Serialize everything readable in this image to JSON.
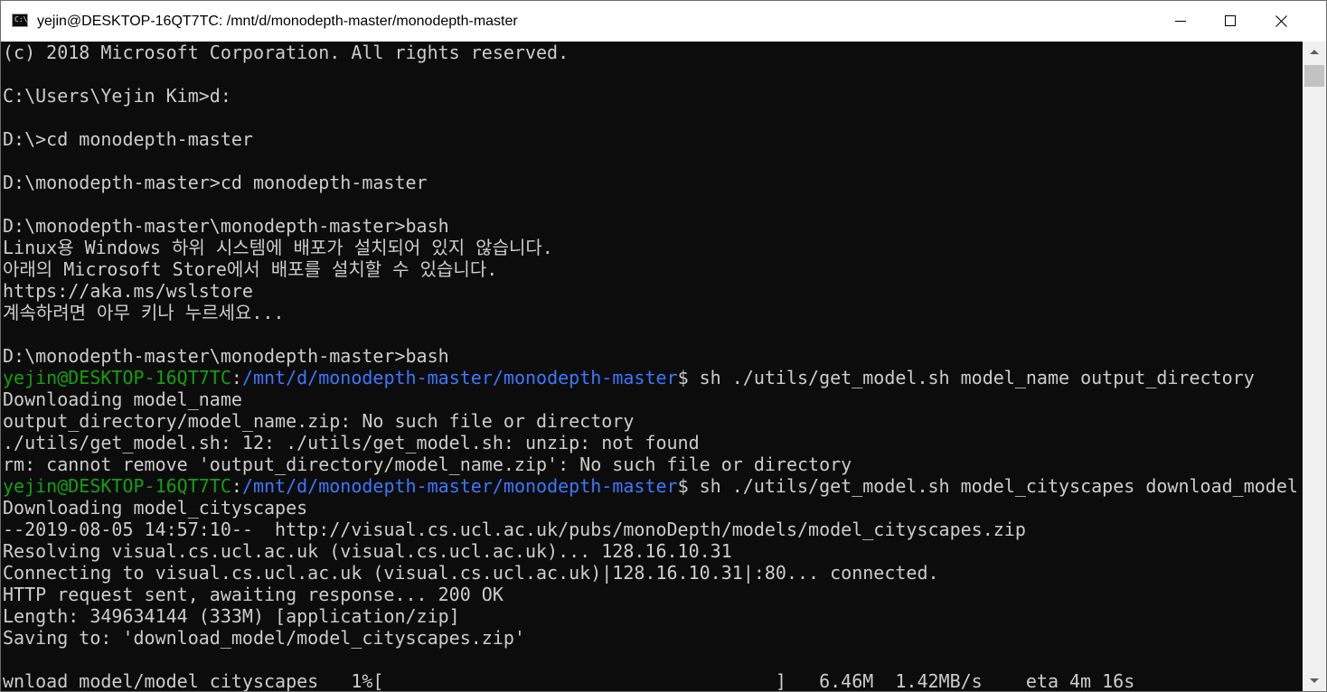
{
  "window": {
    "title": "yejin@DESKTOP-16QT7TC: /mnt/d/monodepth-master/monodepth-master",
    "icon_glyph": "C:\\",
    "colors": {
      "background": "#0c0c0c",
      "text": "#cccccc",
      "prompt_user": "#13a10e",
      "prompt_path": "#3b78ff"
    }
  },
  "console": {
    "lines": [
      {
        "text": "(c) 2018 Microsoft Corporation. All rights reserved."
      },
      {
        "text": ""
      },
      {
        "text": "C:\\Users\\Yejin Kim>d:"
      },
      {
        "text": ""
      },
      {
        "text": "D:\\>cd monodepth-master"
      },
      {
        "text": ""
      },
      {
        "text": "D:\\monodepth-master>cd monodepth-master"
      },
      {
        "text": ""
      },
      {
        "text": "D:\\monodepth-master\\monodepth-master>bash"
      },
      {
        "text": "Linux용 Windows 하위 시스템에 배포가 설치되어 있지 않습니다."
      },
      {
        "text": "아래의 Microsoft Store에서 배포를 설치할 수 있습니다."
      },
      {
        "text": "https://aka.ms/wslstore"
      },
      {
        "text": "계속하려면 아무 키나 누르세요..."
      },
      {
        "text": ""
      },
      {
        "text": "D:\\monodepth-master\\monodepth-master>bash"
      },
      {
        "user": "yejin@DESKTOP-16QT7TC",
        "sep": ":",
        "path": "/mnt/d/monodepth-master/monodepth-master",
        "cmd": "$ sh ./utils/get_model.sh model_name output_directory"
      },
      {
        "text": "Downloading model_name"
      },
      {
        "text": "output_directory/model_name.zip: No such file or directory"
      },
      {
        "text": "./utils/get_model.sh: 12: ./utils/get_model.sh: unzip: not found"
      },
      {
        "text": "rm: cannot remove 'output_directory/model_name.zip': No such file or directory"
      },
      {
        "user": "yejin@DESKTOP-16QT7TC",
        "sep": ":",
        "path": "/mnt/d/monodepth-master/monodepth-master",
        "cmd": "$ sh ./utils/get_model.sh model_cityscapes download_model"
      },
      {
        "text": "Downloading model_cityscapes"
      },
      {
        "text": "--2019-08-05 14:57:10--  http://visual.cs.ucl.ac.uk/pubs/monoDepth/models/model_cityscapes.zip"
      },
      {
        "text": "Resolving visual.cs.ucl.ac.uk (visual.cs.ucl.ac.uk)... 128.16.10.31"
      },
      {
        "text": "Connecting to visual.cs.ucl.ac.uk (visual.cs.ucl.ac.uk)|128.16.10.31|:80... connected."
      },
      {
        "text": "HTTP request sent, awaiting response... 200 OK"
      },
      {
        "text": "Length: 349634144 (333M) [application/zip]"
      },
      {
        "text": "Saving to: 'download_model/model_cityscapes.zip'"
      },
      {
        "text": ""
      },
      {
        "text": "wnload_model/model_cityscapes   1%[                                    ]   6.46M  1.42MB/s    eta 4m 16s"
      }
    ]
  }
}
